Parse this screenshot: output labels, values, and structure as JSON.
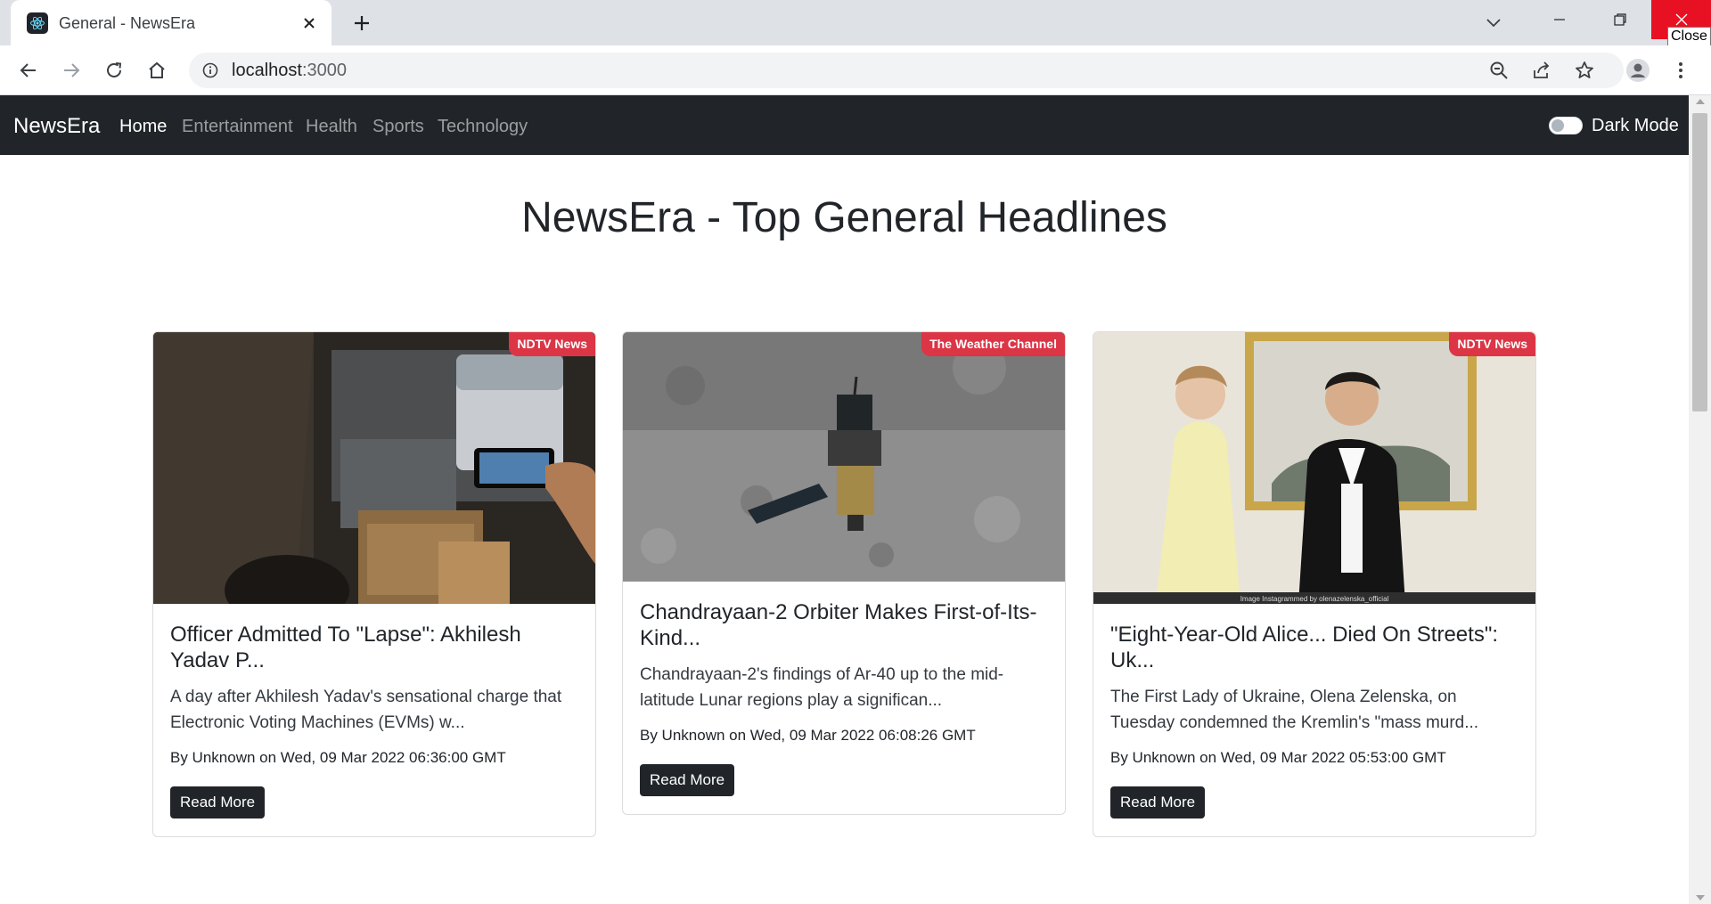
{
  "browser": {
    "tab_title": "General - NewsEra",
    "url_host": "localhost",
    "url_port": ":3000",
    "tooltip": "Close"
  },
  "navbar": {
    "brand": "NewsEra",
    "links": [
      "Home",
      "Entertainment",
      "Health",
      "Sports",
      "Technology"
    ],
    "active": "Home",
    "toggle_label": "Dark Mode"
  },
  "heading": "NewsEra - Top General Headlines",
  "cards": [
    {
      "source": "NDTV News",
      "title": "Officer Admitted To \"Lapse\": Akhilesh Yadav P...",
      "description": "A day after Akhilesh Yadav's sensational charge that Electronic Voting Machines (EVMs) w...",
      "meta": "By Unknown on Wed, 09 Mar 2022 06:36:00 GMT",
      "button": "Read More"
    },
    {
      "source": "The Weather Channel",
      "title": "Chandrayaan-2 Orbiter Makes First-of-Its-Kind...",
      "description": "Chandrayaan-2's findings of Ar-40 up to the mid-latitude Lunar regions play a significan...",
      "meta": "By Unknown on Wed, 09 Mar 2022 06:08:26 GMT",
      "button": "Read More"
    },
    {
      "source": "NDTV News",
      "title": "\"Eight-Year-Old Alice... Died On Streets\": Uk...",
      "description": "The First Lady of Ukraine, Olena Zelenska, on Tuesday condemned the Kremlin's \"mass murd...",
      "meta": "By Unknown on Wed, 09 Mar 2022 05:53:00 GMT",
      "button": "Read More",
      "image_caption": "Image Instagrammed by olenazelenska_official"
    }
  ],
  "colors": {
    "navbar_bg": "#212529",
    "badge_bg": "#dc3545",
    "button_bg": "#212529",
    "close_button_bg": "#e81123"
  }
}
